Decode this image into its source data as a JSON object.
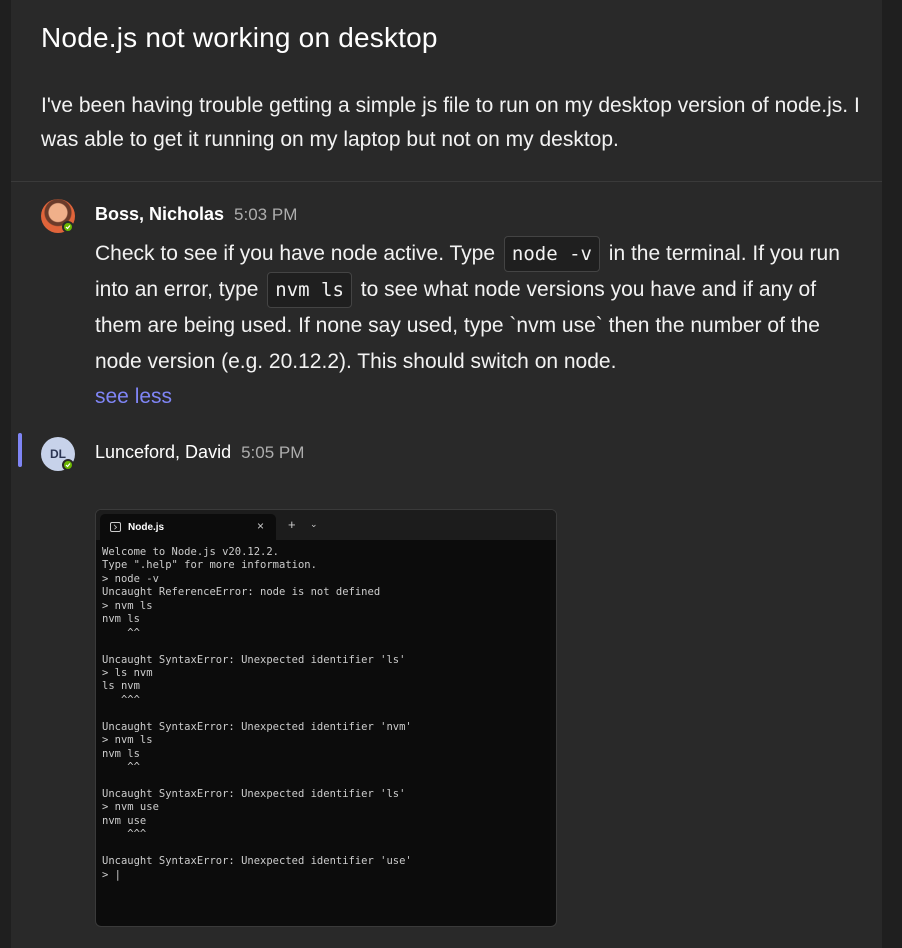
{
  "post": {
    "title": "Node.js not working on desktop",
    "body": "I've been having trouble getting a simple js file to run on my desktop version of node.js. I was able to get it running on my laptop but not on my desktop."
  },
  "reply1": {
    "author": "Boss, Nicholas",
    "time": "5:03 PM",
    "text_1": "Check to see if you have node active. Type",
    "code_1": "node -v",
    "text_2": "in the terminal. If you run into an error, type",
    "code_2": "nvm ls",
    "text_3": "to see what node versions you have and if any of them are being used. If none say used, type `nvm use` then the number of the node version (e.g. 20.12.2). This should switch on node.",
    "see_less": "see less",
    "presence": "available"
  },
  "reply2": {
    "author": "Lunceford, David",
    "initials": "DL",
    "time": "5:05 PM",
    "presence": "available"
  },
  "terminal": {
    "tab_title": "Node.js",
    "close_glyph": "×",
    "new_tab_glyph": "+",
    "dropdown_glyph": "⌄",
    "lines": [
      "Welcome to Node.js v20.12.2.",
      "Type \".help\" for more information.",
      "> node -v",
      "Uncaught ReferenceError: node is not defined",
      "> nvm ls",
      "nvm ls",
      "    ^^",
      "",
      "Uncaught SyntaxError: Unexpected identifier 'ls'",
      "> ls nvm",
      "ls nvm",
      "   ^^^",
      "",
      "Uncaught SyntaxError: Unexpected identifier 'nvm'",
      "> nvm ls",
      "nvm ls",
      "    ^^",
      "",
      "Uncaught SyntaxError: Unexpected identifier 'ls'",
      "> nvm use",
      "nvm use",
      "    ^^^",
      "",
      "Uncaught SyntaxError: Unexpected identifier 'use'",
      "> |"
    ]
  },
  "colors": {
    "accent": "#7f85f5",
    "presence_green": "#6bb700",
    "background": "#292929"
  }
}
